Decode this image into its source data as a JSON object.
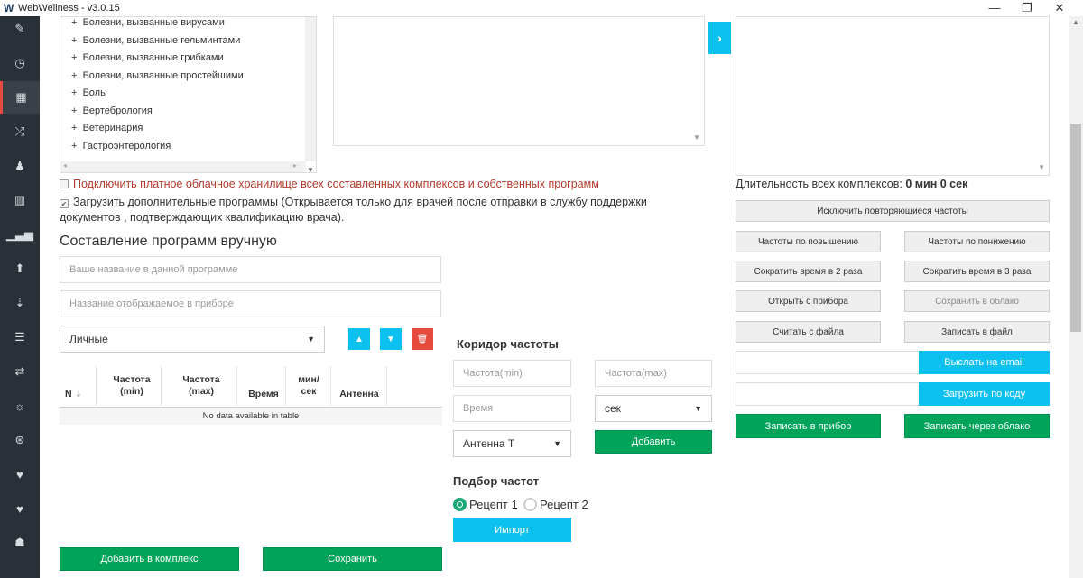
{
  "window": {
    "title": "WebWellness - v3.0.15",
    "min": "—",
    "max": "❐",
    "close": "✕"
  },
  "tree_items": [
    "Болезни, вызванные вирусами",
    "Болезни, вызванные гельминтами",
    "Болезни, вызванные грибками",
    "Болезни, вызванные простейшими",
    "Боль",
    "Вертебрология",
    "Ветеринария",
    "Гастроэнтерология"
  ],
  "tree_prefix": "+",
  "cloud_storage_label": "Подключить платное облачное хранилище всех составленных комплексов и собственных программ",
  "extra_programs_label": "Загрузить дополнительные программы (Открывается только для врачей после отправки в службу поддержки документов , подтверждающих квалификацию врача).",
  "manual_title": "Составление программ вручную",
  "name_placeholder": "Ваше название в данной программе",
  "device_name_placeholder": "Название отображаемое в приборе",
  "category_select": "Личные",
  "table": {
    "headers": [
      "N",
      "Частота (min)",
      "Частота (max)",
      "Время",
      "мин/ сек",
      "Антенна"
    ],
    "empty": "No data available in table"
  },
  "add_to_complex": "Добавить в комплекс",
  "save": "Сохранить",
  "corridor": {
    "title": "Коридор частоты",
    "freq_min": "Частота(min)",
    "freq_max": "Частота(max)",
    "time": "Время",
    "unit": "сек",
    "antenna": "Антенна Т",
    "add": "Добавить"
  },
  "selection": {
    "title": "Подбор частот",
    "recipe1": "Рецепт 1",
    "recipe2": "Рецепт 2",
    "import": "Импорт"
  },
  "duration": {
    "label": "Длительность всех комплексов:",
    "value": "0 мин 0 сек"
  },
  "actions": {
    "exclude_repeats": "Исключить повторяющиеся частоты",
    "ascending": "Частоты по повышению",
    "descending": "Частоты по понижению",
    "halve_time": "Сократить время в 2 раза",
    "third_time": "Сократить время в 3 раза",
    "open_device": "Открыть с прибора",
    "save_cloud": "Сохранить в облако",
    "read_file": "Считать с файла",
    "write_file": "Записать в файл",
    "send_email": "Выслать на email",
    "load_code": "Загрузить по коду",
    "write_device": "Записать в прибор",
    "write_cloud": "Записать через облако"
  },
  "colors": {
    "green": "#00a35a",
    "blue": "#0cc0f0",
    "red": "#e54b3c",
    "sidebar": "#2a3038"
  }
}
